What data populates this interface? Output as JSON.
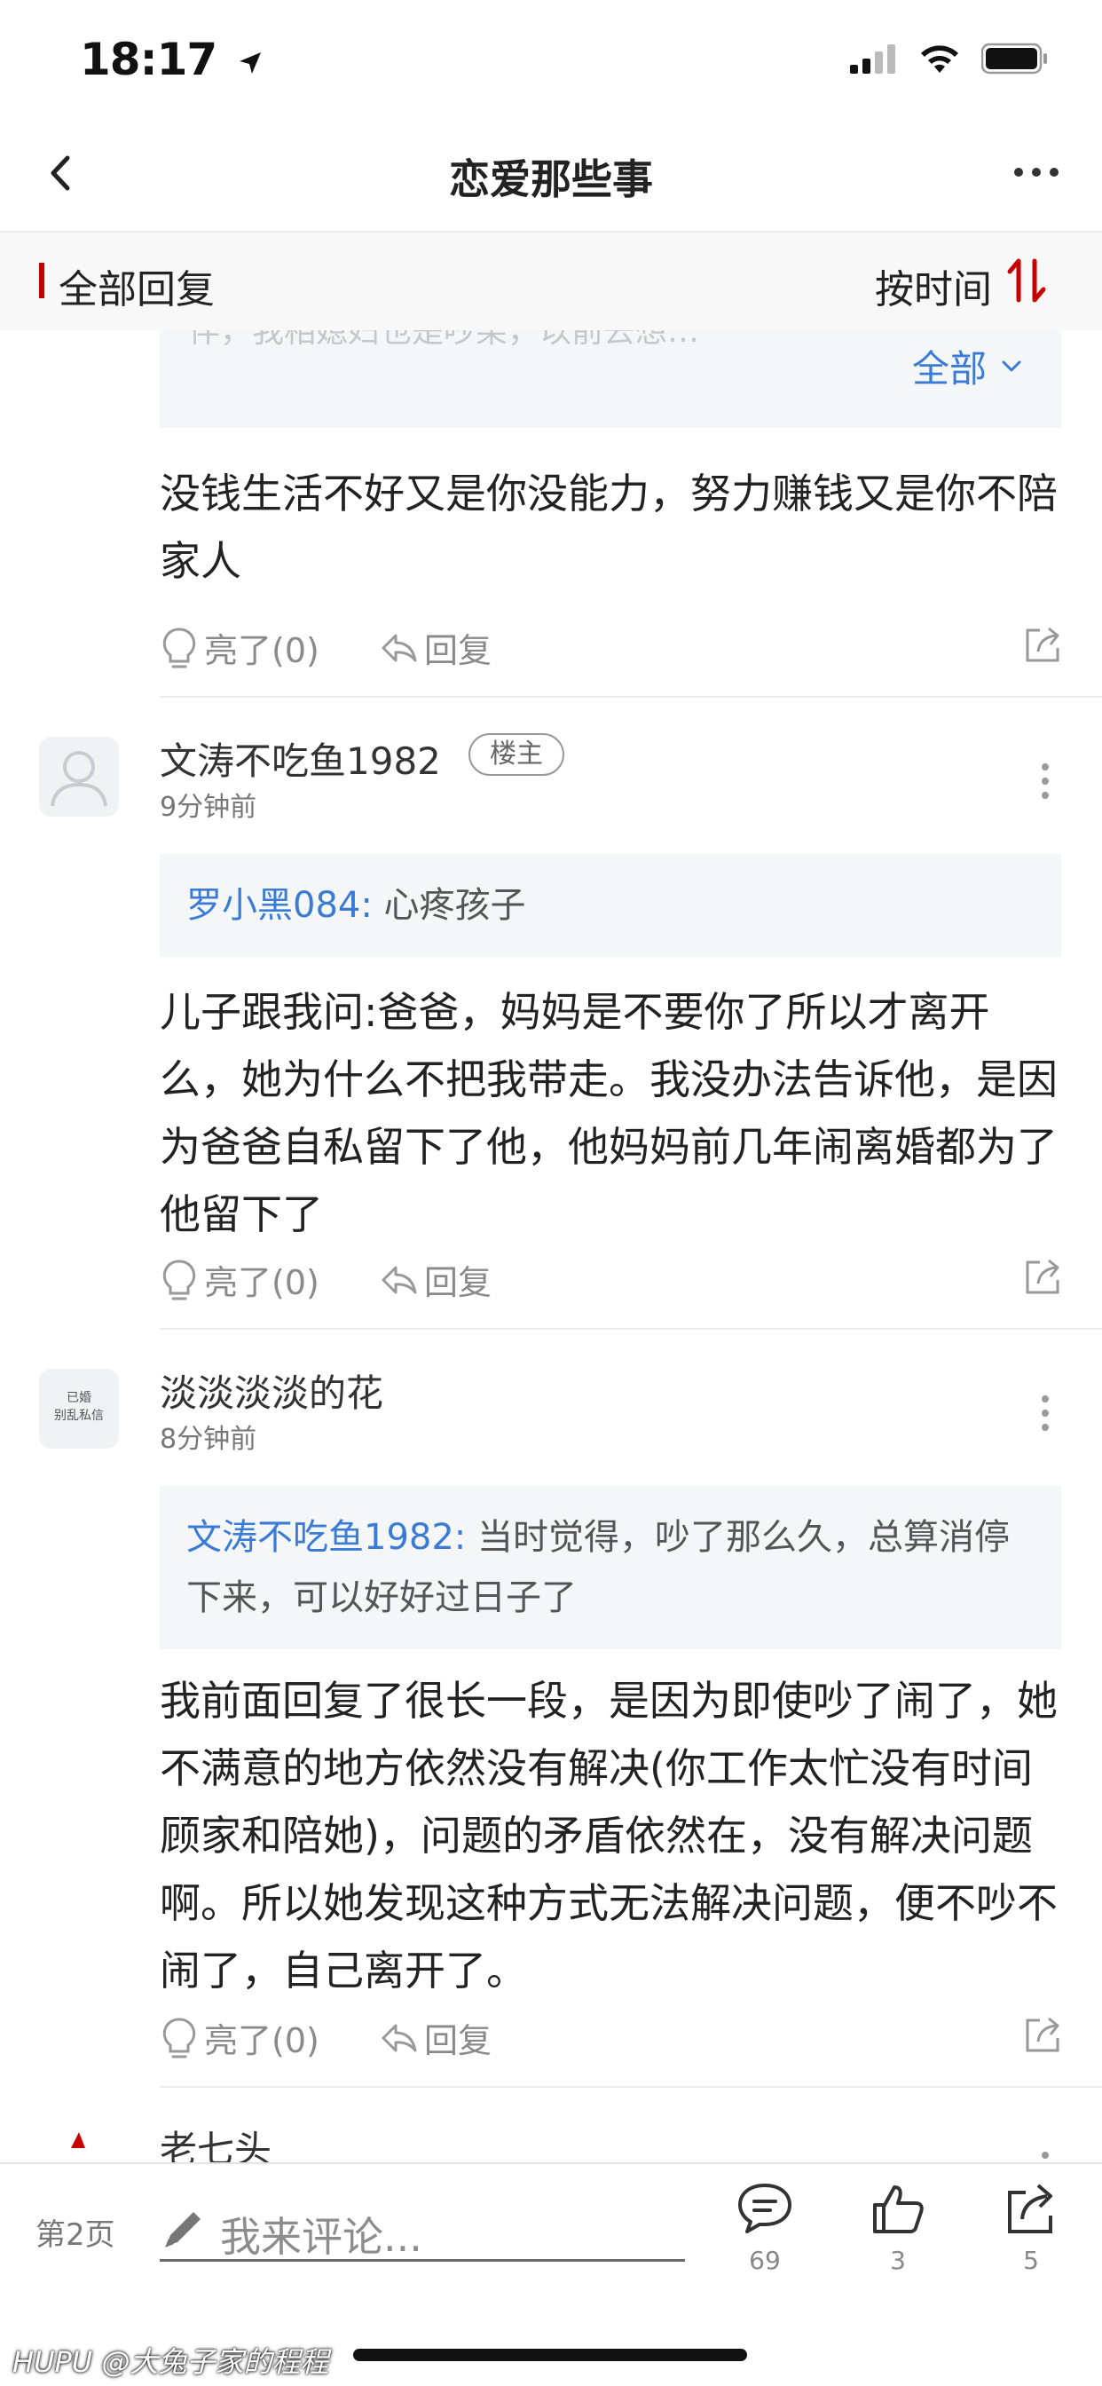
{
  "status_bar": {
    "time": "18:17"
  },
  "nav": {
    "title": "恋爱那些事"
  },
  "section": {
    "title": "全部回复",
    "sort_label": "按时间"
  },
  "colors": {
    "accent_red": "#c60100",
    "link_blue": "#3a7bd5"
  },
  "posts": [
    {
      "quote_partial": "伴，我相媳妇也是吵架，以前去想…",
      "expand_label": "全部",
      "text": "没钱生活不好又是你没能力，努力赚钱又是你不陪家人",
      "like_label": "亮了(0)",
      "reply_label": "回复"
    },
    {
      "username": "文涛不吃鱼1982",
      "badge": "楼主",
      "time": "9分钟前",
      "quote_name": "罗小黑084:",
      "quote_text": " 心疼孩子",
      "text": "儿子跟我问:爸爸，妈妈是不要你了所以才离开么，她为什么不把我带走。我没办法告诉他，是因为爸爸自私留下了他，他妈妈前几年闹离婚都为了他留下了",
      "like_label": "亮了(0)",
      "reply_label": "回复"
    },
    {
      "username": "淡淡淡淡的花",
      "avatar_text_1": "已婚",
      "avatar_text_2": "别乱私信",
      "time": "8分钟前",
      "quote_name": "文涛不吃鱼1982:",
      "quote_text": " 当时觉得，吵了那么久，总算消停下来，可以好好过日子了",
      "text": "我前面回复了很长一段，是因为即使吵了闹了，她不满意的地方依然没有解决(你工作太忙没有时间顾家和陪她)，问题的矛盾依然在，没有解决问题啊。所以她发现这种方式无法解决问题，便不吵不闹了，自己离开了。",
      "like_label": "亮了(0)",
      "reply_label": "回复"
    },
    {
      "username": "老七头"
    }
  ],
  "bottom_bar": {
    "page_label": "第2页",
    "input_placeholder": "我来评论...",
    "comments_count": "69",
    "likes_count": "3",
    "shares_count": "5"
  },
  "watermark": "HUPU @大兔子家的程程"
}
